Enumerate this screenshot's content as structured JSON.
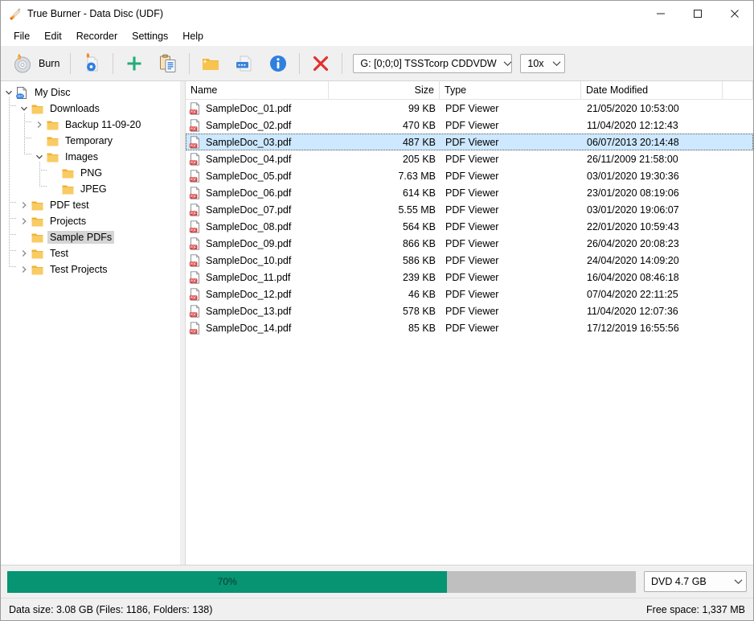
{
  "window": {
    "title": "True Burner - Data Disc (UDF)",
    "app_icon": "flame-torch-icon",
    "minimize_label": "—",
    "maximize_label": "□",
    "close_label": "✕"
  },
  "menubar": {
    "items": [
      {
        "label": "File"
      },
      {
        "label": "Edit"
      },
      {
        "label": "Recorder"
      },
      {
        "label": "Settings"
      },
      {
        "label": "Help"
      }
    ]
  },
  "toolbar": {
    "burn_label": "Burn",
    "burn_icon": "burn-disc-icon",
    "burn_image_icon": "burn-image-file-icon",
    "add_icon": "plus-add-icon",
    "paste_icon": "clipboard-paste-icon",
    "new_folder_icon": "new-folder-icon",
    "rename_icon": "rename-file-icon",
    "info_icon": "info-icon",
    "delete_icon": "delete-x-icon",
    "drive": {
      "value": "G: [0;0;0] TSSTcorp CDDVDW",
      "arrow_icon": "chevron-down-icon"
    },
    "speed": {
      "value": "10x",
      "arrow_icon": "chevron-down-icon"
    }
  },
  "tree": {
    "root_icon": "iso-disc-file-icon",
    "folder_icon": "folder-icon",
    "expanded_icon": "chevron-down-icon",
    "collapsed_icon": "chevron-right-icon",
    "nodes": [
      {
        "label": "My Disc",
        "depth": 0,
        "state": "expanded",
        "icon": "iso",
        "selected": false
      },
      {
        "label": "Downloads",
        "depth": 1,
        "state": "expanded",
        "icon": "folder",
        "selected": false
      },
      {
        "label": "Backup 11-09-20",
        "depth": 2,
        "state": "collapsed",
        "icon": "folder",
        "selected": false
      },
      {
        "label": "Temporary",
        "depth": 2,
        "state": "leaf",
        "icon": "folder",
        "selected": false
      },
      {
        "label": "Images",
        "depth": 2,
        "state": "expanded",
        "icon": "folder",
        "selected": false
      },
      {
        "label": "PNG",
        "depth": 3,
        "state": "leaf",
        "icon": "folder",
        "selected": false
      },
      {
        "label": "JPEG",
        "depth": 3,
        "state": "leaf",
        "icon": "folder",
        "selected": false
      },
      {
        "label": "PDF test",
        "depth": 1,
        "state": "collapsed",
        "icon": "folder",
        "selected": false
      },
      {
        "label": "Projects",
        "depth": 1,
        "state": "collapsed",
        "icon": "folder",
        "selected": false
      },
      {
        "label": "Sample PDFs",
        "depth": 1,
        "state": "leaf",
        "icon": "folder",
        "selected": true
      },
      {
        "label": "Test",
        "depth": 1,
        "state": "collapsed",
        "icon": "folder",
        "selected": false
      },
      {
        "label": "Test Projects",
        "depth": 1,
        "state": "collapsed",
        "icon": "folder",
        "selected": false
      }
    ]
  },
  "filelist": {
    "columns": [
      {
        "label": "Name",
        "align": "left"
      },
      {
        "label": "Size",
        "align": "right"
      },
      {
        "label": "Type",
        "align": "left"
      },
      {
        "label": "Date Modified",
        "align": "left"
      }
    ],
    "file_icon": "pdf-file-icon",
    "rows": [
      {
        "name": "SampleDoc_01.pdf",
        "size": "99 KB",
        "type": "PDF Viewer",
        "date": "21/05/2020 10:53:00",
        "selected": false
      },
      {
        "name": "SampleDoc_02.pdf",
        "size": "470 KB",
        "type": "PDF Viewer",
        "date": "11/04/2020 12:12:43",
        "selected": false
      },
      {
        "name": "SampleDoc_03.pdf",
        "size": "487 KB",
        "type": "PDF Viewer",
        "date": "06/07/2013 20:14:48",
        "selected": true
      },
      {
        "name": "SampleDoc_04.pdf",
        "size": "205 KB",
        "type": "PDF Viewer",
        "date": "26/11/2009 21:58:00",
        "selected": false
      },
      {
        "name": "SampleDoc_05.pdf",
        "size": "7.63 MB",
        "type": "PDF Viewer",
        "date": "03/01/2020 19:30:36",
        "selected": false
      },
      {
        "name": "SampleDoc_06.pdf",
        "size": "614 KB",
        "type": "PDF Viewer",
        "date": "23/01/2020 08:19:06",
        "selected": false
      },
      {
        "name": "SampleDoc_07.pdf",
        "size": "5.55 MB",
        "type": "PDF Viewer",
        "date": "03/01/2020 19:06:07",
        "selected": false
      },
      {
        "name": "SampleDoc_08.pdf",
        "size": "564 KB",
        "type": "PDF Viewer",
        "date": "22/01/2020 10:59:43",
        "selected": false
      },
      {
        "name": "SampleDoc_09.pdf",
        "size": "866 KB",
        "type": "PDF Viewer",
        "date": "26/04/2020 20:08:23",
        "selected": false
      },
      {
        "name": "SampleDoc_10.pdf",
        "size": "586 KB",
        "type": "PDF Viewer",
        "date": "24/04/2020 14:09:20",
        "selected": false
      },
      {
        "name": "SampleDoc_11.pdf",
        "size": "239 KB",
        "type": "PDF Viewer",
        "date": "16/04/2020 08:46:18",
        "selected": false
      },
      {
        "name": "SampleDoc_12.pdf",
        "size": "46 KB",
        "type": "PDF Viewer",
        "date": "07/04/2020 22:11:25",
        "selected": false
      },
      {
        "name": "SampleDoc_13.pdf",
        "size": "578 KB",
        "type": "PDF Viewer",
        "date": "11/04/2020 12:07:36",
        "selected": false
      },
      {
        "name": "SampleDoc_14.pdf",
        "size": "85 KB",
        "type": "PDF Viewer",
        "date": "17/12/2019 16:55:56",
        "selected": false
      }
    ]
  },
  "bottom": {
    "progress": {
      "percent_label": "70%",
      "percent_value": 70,
      "fill_color": "#069472",
      "track_color": "#bfbfbf"
    },
    "media": {
      "value": "DVD 4.7 GB",
      "arrow_icon": "chevron-down-icon"
    },
    "status_left": "Data size: 3.08 GB (Files: 1186, Folders: 138)",
    "status_right": "Free space: 1,337 MB"
  }
}
